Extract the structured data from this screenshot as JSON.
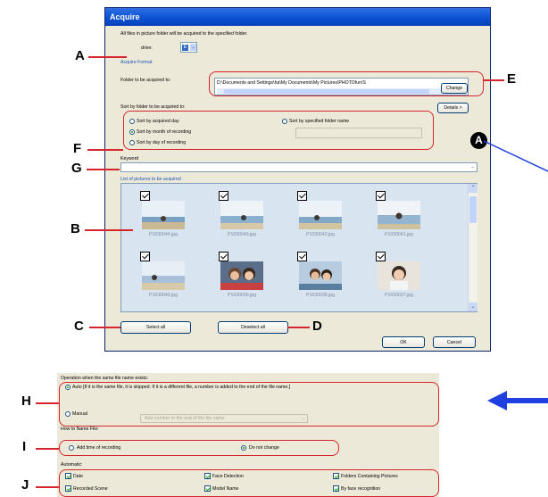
{
  "dialog": {
    "title": "Acquire",
    "intro": "All files in picture folder will be acquired to the specified folder.",
    "drive_label": "drive:",
    "drive_value": "E",
    "acquire_format_label": "Acquire Format",
    "folder_label": "Folder to be acquired to:",
    "folder_path": "D:\\Documents and Settings\\ha\\My Documents\\My Pictures\\PHOTOfun\\S",
    "change_label": "Change",
    "sort_label": "Sort by folder to be acquired to:",
    "details_label": "Details >",
    "sort_options": [
      "Sort by acquired day",
      "Sort by month of recording",
      "Sort by day of recording"
    ],
    "sort_specified": "Sort by specified folder name",
    "keyword_label": "Keyword",
    "list_label": "List of pictures to be acquired",
    "pictures": [
      "P1030044.jpg",
      "P1030043.jpg",
      "P1030042.jpg",
      "P1030041.jpg",
      "P1030040.jpg",
      "P1030039.jpg",
      "P1030038.jpg",
      "P1030037.jpg"
    ],
    "select_all": "Select all",
    "deselect_all": "Deselect all",
    "ok": "OK",
    "cancel": "Cancel"
  },
  "lower": {
    "operation_label": "Operation when the same file name exists:",
    "auto_text": "Auto  [If it is the same file, it is skipped. If it is a different file, a number is added to the end of the file name.]",
    "manual_text": "Manual",
    "manual_dropdown": "Add number to the end of the file name",
    "name_label": "How to Name File:",
    "add_time": "Add time of recording",
    "do_not_change": "Do not change",
    "automatic_label": "Automatic:",
    "checks": [
      "Date",
      "Face Detection",
      "Folders Containing Pictures",
      "Recorded Scene",
      "Model Name",
      "By face recognition"
    ]
  },
  "callouts": {
    "A": "A",
    "B": "B",
    "C": "C",
    "D": "D",
    "E": "E",
    "F": "F",
    "G": "G",
    "H": "H",
    "I": "I",
    "J": "J",
    "badge": "A"
  },
  "colors": {
    "callout_outline": "#d4262c",
    "arrow": "#1f3fe0",
    "title_bar": "#0a4fd1"
  }
}
